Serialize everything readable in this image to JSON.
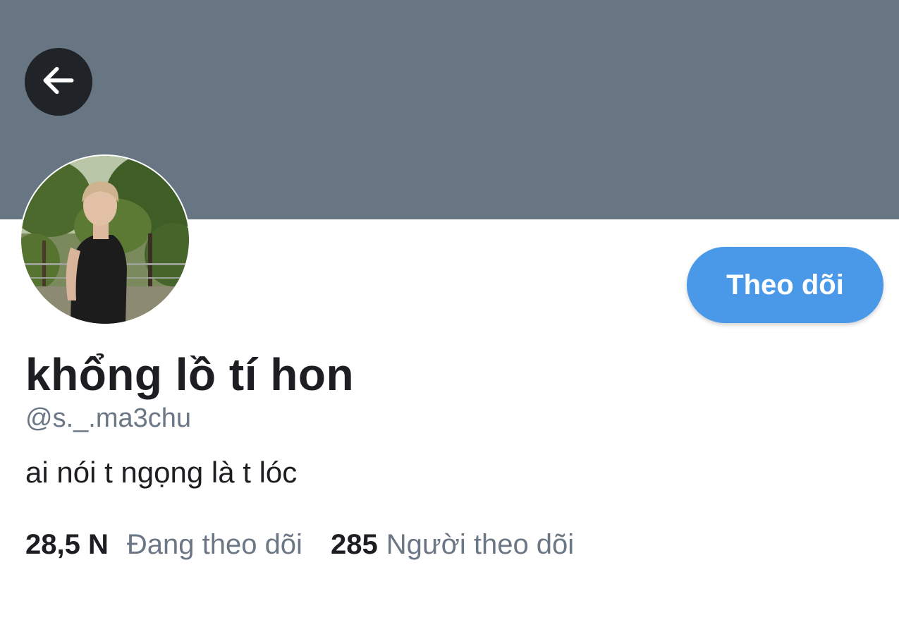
{
  "profile": {
    "display_name": "khổng lồ tí hon",
    "handle": "@s._.ma3chu",
    "bio": "ai nói t ngọng là t lóc",
    "follow_button_label": "Theo dõi",
    "stats": {
      "following_count": "28,5 N",
      "following_label": "Đang theo dõi",
      "followers_count": "285",
      "followers_label": "Người theo dõi"
    }
  },
  "icons": {
    "back": "arrow-left-icon"
  },
  "colors": {
    "banner": "#687684",
    "back_button": "#202327",
    "follow_button": "#4a99e9",
    "secondary_text": "#6b7785",
    "primary_text": "#1c1e21"
  }
}
